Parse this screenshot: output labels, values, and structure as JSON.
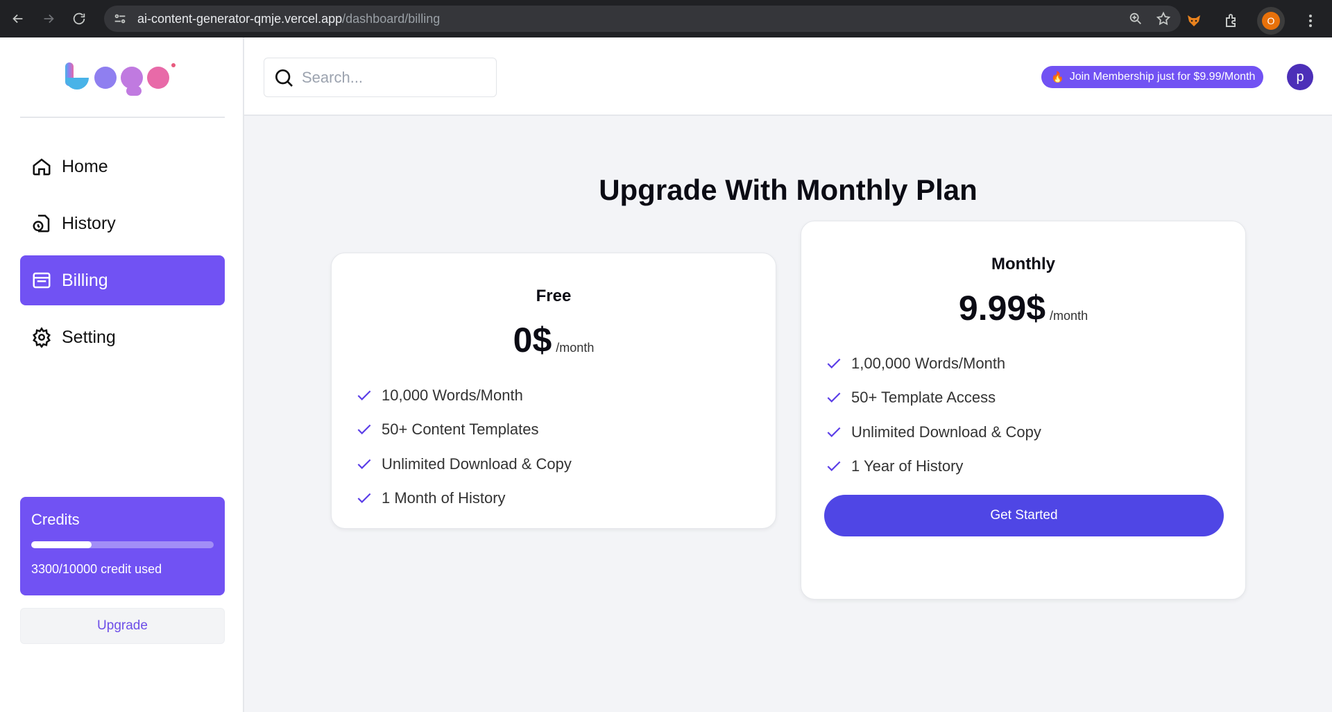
{
  "browser": {
    "url_host": "ai-content-generator-qmje.vercel.app",
    "url_path": "/dashboard/billing",
    "profile_initial": "O"
  },
  "sidebar": {
    "items": [
      {
        "label": "Home",
        "icon": "home-icon",
        "active": false
      },
      {
        "label": "History",
        "icon": "history-icon",
        "active": false
      },
      {
        "label": "Billing",
        "icon": "billing-icon",
        "active": true
      },
      {
        "label": "Setting",
        "icon": "gear-icon",
        "active": false
      }
    ],
    "credits": {
      "title": "Credits",
      "used_text": "3300/10000 credit used",
      "used": 3300,
      "total": 10000
    },
    "upgrade_label": "Upgrade"
  },
  "header": {
    "search_placeholder": "Search...",
    "promo_label": "Join Membership just for $9.99/Month",
    "avatar_initial": "p"
  },
  "main": {
    "title": "Upgrade With Monthly Plan",
    "plans": [
      {
        "name": "Free",
        "price": "0$",
        "per": "/month",
        "features": [
          "10,000 Words/Month",
          "50+ Content Templates",
          "Unlimited Download & Copy",
          "1 Month of History"
        ]
      },
      {
        "name": "Monthly",
        "price": "9.99$",
        "per": "/month",
        "features": [
          "1,00,000 Words/Month",
          "50+ Template Access",
          "Unlimited Download & Copy",
          "1 Year of History"
        ],
        "cta": "Get Started"
      }
    ]
  },
  "colors": {
    "accent": "#7152f3",
    "button": "#4f46e5",
    "background": "#f3f4f7"
  }
}
